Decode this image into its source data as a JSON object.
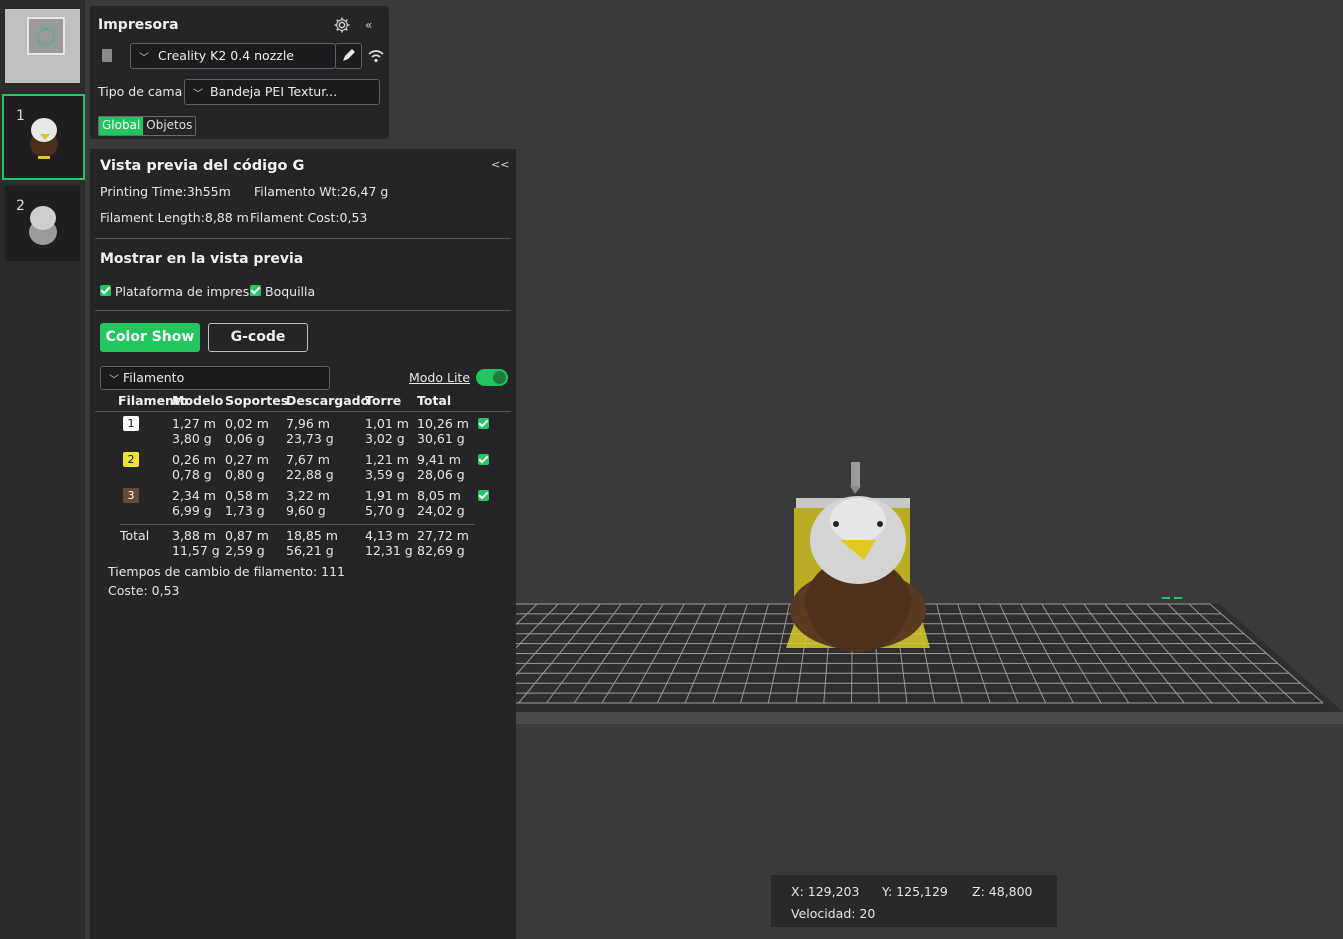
{
  "printer_panel": {
    "title": "Impresora",
    "printer_name": "Creality K2 0.4 nozzle",
    "bed_label": "Tipo de cama",
    "bed_value": "Bandeja PEI Textur...",
    "tabs": [
      "Global",
      "Objetos"
    ],
    "active_tab": "Global",
    "collapse": "«"
  },
  "plates": [
    {
      "number": "",
      "selected": false
    },
    {
      "number": "1",
      "selected": true
    },
    {
      "number": "2",
      "selected": false
    }
  ],
  "gcode_panel": {
    "title": "Vista previa del código G",
    "collapse": "<<",
    "printing_time": "Printing Time:3h55m",
    "filament_wt": "Filamento Wt:26,47 g",
    "filament_length": "Filament Length:8,88 m",
    "filament_cost": "Filament Cost:0,53",
    "show_title": "Mostrar en la vista previa",
    "show_plate": "Plataforma de impresió",
    "show_nozzle": "Boquilla",
    "btn_color_show": "Color Show",
    "btn_gcode": "G-code",
    "view_type": "Filamento",
    "lite_mode": "Modo Lite",
    "lite_on": true,
    "headers": [
      "Filamento",
      "Modelo",
      "Soportes",
      "Descargado",
      "Torre",
      "Total"
    ],
    "rows": [
      {
        "id": "1",
        "color": "#ffffff",
        "text_color": "#111111",
        "modelo": [
          "1,27 m",
          "3,80 g"
        ],
        "soportes": [
          "0,02 m",
          "0,06 g"
        ],
        "descargado": [
          "7,96 m",
          "23,73 g"
        ],
        "torre": [
          "1,01 m",
          "3,02 g"
        ],
        "total": [
          "10,26 m",
          "30,61 g"
        ]
      },
      {
        "id": "2",
        "color": "#f2e233",
        "text_color": "#111111",
        "modelo": [
          "0,26 m",
          "0,78 g"
        ],
        "soportes": [
          "0,27 m",
          "0,80 g"
        ],
        "descargado": [
          "7,67 m",
          "22,88 g"
        ],
        "torre": [
          "1,21 m",
          "3,59 g"
        ],
        "total": [
          "9,41 m",
          "28,06 g"
        ]
      },
      {
        "id": "3",
        "color": "#6b4a33",
        "text_color": "#ffffff",
        "modelo": [
          "2,34 m",
          "6,99 g"
        ],
        "soportes": [
          "0,58 m",
          "1,73 g"
        ],
        "descargado": [
          "3,22 m",
          "9,60 g"
        ],
        "torre": [
          "1,91 m",
          "5,70 g"
        ],
        "total": [
          "8,05 m",
          "24,02 g"
        ]
      }
    ],
    "total_row": {
      "label": "Total",
      "modelo": [
        "3,88 m",
        "11,57 g"
      ],
      "soportes": [
        "0,87 m",
        "2,59 g"
      ],
      "descargado": [
        "18,85 m",
        "56,21 g"
      ],
      "torre": [
        "4,13 m",
        "12,31 g"
      ],
      "total": [
        "27,72 m",
        "82,69 g"
      ]
    },
    "change_times": "Tiempos de cambio de filamento:  111",
    "cost": "Coste:  0,53"
  },
  "coords": {
    "x": "X: 129,203",
    "y": "Y: 125,129",
    "z": "Z: 48,800",
    "speed": "Velocidad: 20"
  },
  "colors": {
    "accent": "#22c55e",
    "bed": "#2c2c2e",
    "grid": "#cfcfcf"
  }
}
